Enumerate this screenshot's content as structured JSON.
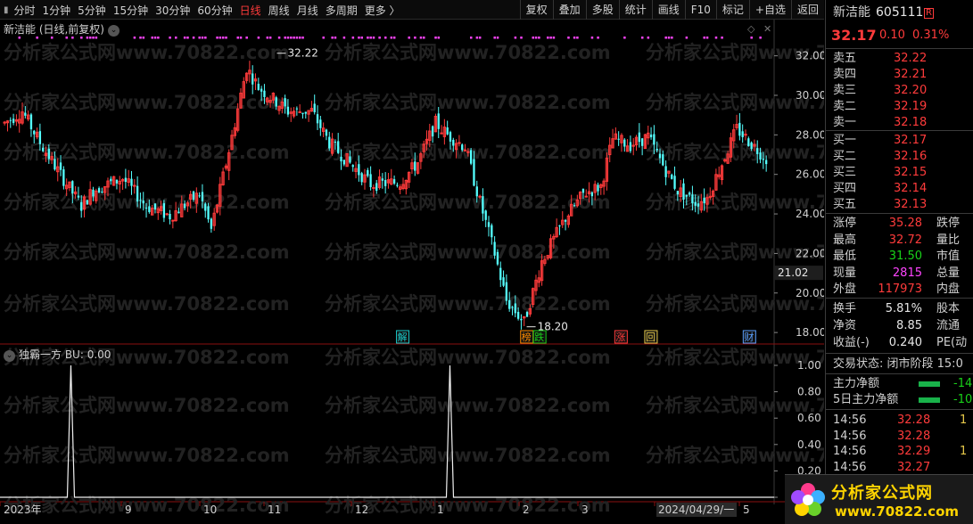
{
  "toolbar": {
    "periods": [
      "分时",
      "1分钟",
      "5分钟",
      "15分钟",
      "30分钟",
      "60分钟",
      "日线",
      "周线",
      "月线",
      "多周期",
      "更多 〉"
    ],
    "active_period": "日线",
    "tools": [
      "复权",
      "叠加",
      "多股",
      "统计",
      "画线",
      "F10",
      "标记",
      "+自选",
      "返回"
    ]
  },
  "main_chart": {
    "title": "新洁能 (日线,前复权)",
    "price_axis": [
      "32.00",
      "30.00",
      "28.00",
      "26.00",
      "24.00",
      "22.00",
      "20.00",
      "18.00"
    ],
    "price_ticks": [
      32,
      30,
      28,
      26,
      24,
      22,
      20,
      18
    ],
    "current_price_label": "21.02",
    "high_annotation": "32.22",
    "low_annotation": "18.20",
    "markers": [
      {
        "label": "解",
        "color": "#19c8c8",
        "index": 92
      },
      {
        "label": "榜",
        "color": "#ff8c00",
        "index": 121
      },
      {
        "label": "跌",
        "color": "#19d219",
        "index": 124
      },
      {
        "label": "涨",
        "color": "#ff3b3b",
        "index": 143
      },
      {
        "label": "回",
        "color": "#e6c84a",
        "index": 150
      },
      {
        "label": "财",
        "color": "#5aa0ff",
        "index": 173
      }
    ],
    "colors": {
      "up": "#ff3b3b",
      "down": "#54ffff",
      "dots": "#ff44ff"
    }
  },
  "indicator": {
    "title": "独霸一方 BU: 0.00",
    "axis": [
      "1.00",
      "0.80",
      "0.60",
      "0.40",
      "0.20",
      "0.00"
    ],
    "axis_ticks": [
      1,
      0.8,
      0.6,
      0.4,
      0.2,
      0
    ],
    "signal_indices": [
      19,
      126
    ]
  },
  "time_axis": [
    "2023年",
    "9",
    "10",
    "11",
    "12",
    "1",
    "2",
    "3",
    "2024/04/29/一",
    "5"
  ],
  "chart_data": {
    "type": "candlestick",
    "price_range": [
      17.6,
      33.2
    ],
    "notes_visible": {
      "high": 32.22,
      "low": 18.2,
      "last": 21.02
    }
  },
  "panel": {
    "name": "新洁能",
    "code": "605111",
    "badge": "R",
    "price": "32.17",
    "change": "0.10",
    "change_pct": "0.31%",
    "asks": [
      {
        "label": "卖五",
        "price": "32.22"
      },
      {
        "label": "卖四",
        "price": "32.21"
      },
      {
        "label": "卖三",
        "price": "32.20"
      },
      {
        "label": "卖二",
        "price": "32.19"
      },
      {
        "label": "卖一",
        "price": "32.18"
      }
    ],
    "bids": [
      {
        "label": "买一",
        "price": "32.17"
      },
      {
        "label": "买二",
        "price": "32.16"
      },
      {
        "label": "买三",
        "price": "32.15"
      },
      {
        "label": "买四",
        "price": "32.14"
      },
      {
        "label": "买五",
        "price": "32.13"
      }
    ],
    "stats": [
      {
        "label": "涨停",
        "value": "35.28",
        "color": "red",
        "label2": "跌停"
      },
      {
        "label": "最高",
        "value": "32.72",
        "color": "red",
        "label2": "量比"
      },
      {
        "label": "最低",
        "value": "31.50",
        "color": "green",
        "label2": "市值"
      },
      {
        "label": "现量",
        "value": "2815",
        "color": "mag",
        "label2": "总量"
      },
      {
        "label": "外盘",
        "value": "117973",
        "color": "red",
        "label2": "内盘"
      }
    ],
    "stats2": [
      {
        "label": "换手",
        "value": "5.81%",
        "color": "white",
        "label2": "股本"
      },
      {
        "label": "净资",
        "value": "8.85",
        "color": "white",
        "label2": "流通"
      },
      {
        "label": "收益(-)",
        "value": "0.240",
        "color": "white",
        "label2": "PE(动"
      }
    ],
    "status": "交易状态: 闭市阶段 15:0",
    "flows": [
      {
        "label": "主力净额",
        "value": "-14"
      },
      {
        "label": "5日主力净额",
        "value": "-10"
      }
    ],
    "ticks": [
      {
        "time": "14:56",
        "price": "32.28",
        "vol": "1"
      },
      {
        "time": "14:56",
        "price": "32.28",
        "vol": ""
      },
      {
        "time": "14:56",
        "price": "32.29",
        "vol": "1"
      },
      {
        "time": "14:56",
        "price": "32.27",
        "vol": ""
      }
    ]
  },
  "logo": {
    "title": "分析家公式网",
    "url": "www.70822.com"
  },
  "watermark": "分析家公式网www.70822.com"
}
